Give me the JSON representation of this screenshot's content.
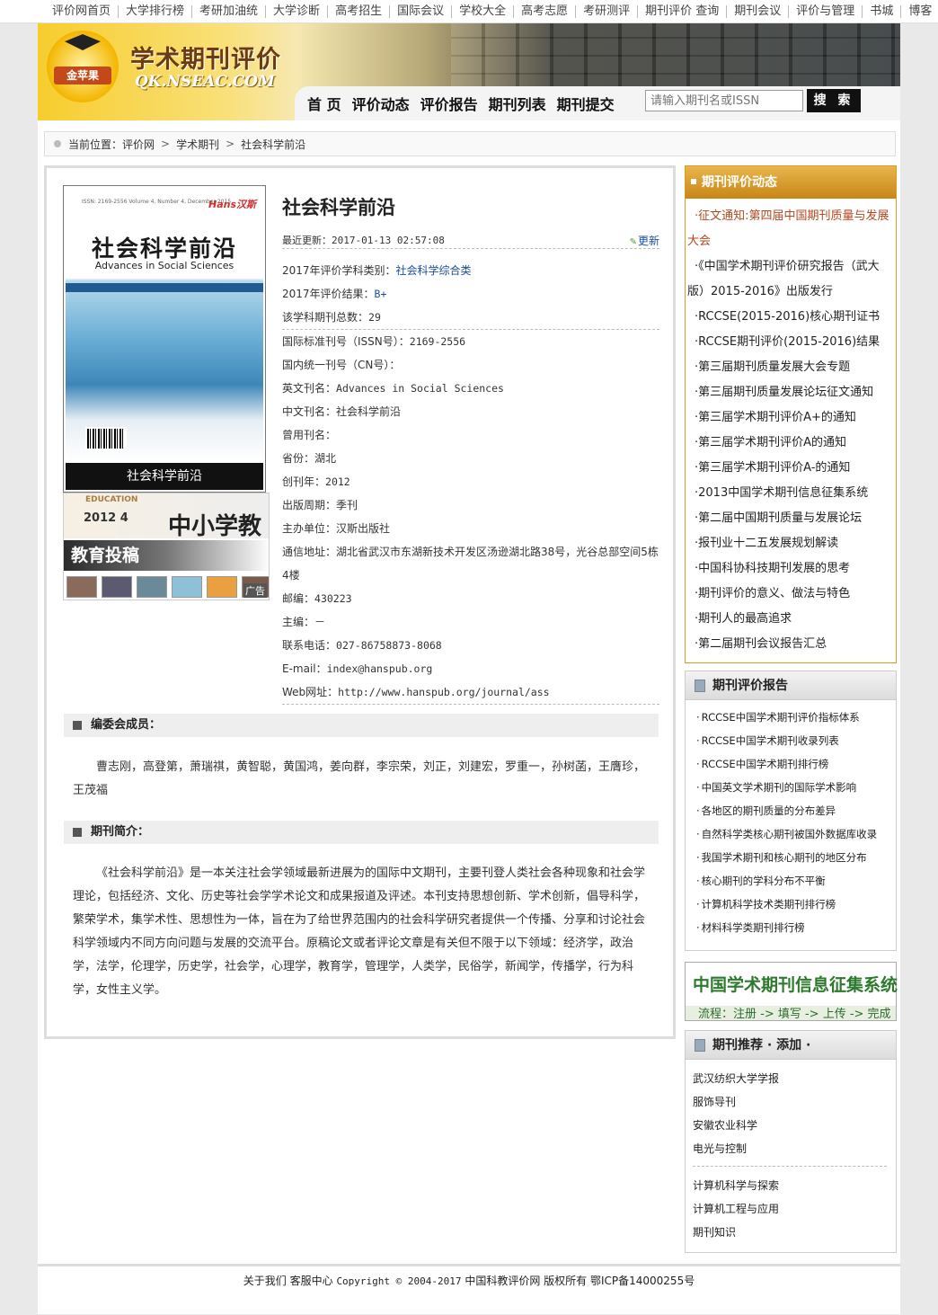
{
  "topnav": [
    "评价网首页",
    "大学排行榜",
    "考研加油统",
    "大学诊断",
    "高考招生",
    "国际会议",
    "学校大全",
    "高考志愿",
    "考研测评",
    "期刊评价 查询",
    "期刊会议",
    "评价与管理",
    "书城",
    "博客"
  ],
  "header": {
    "logo_text": "金苹果",
    "site_name": "学术期刊评价",
    "site_domain": "QK.NSEAC.COM",
    "nav": [
      "首 页",
      "评价动态",
      "评价报告",
      "期刊列表",
      "期刊提交"
    ],
    "search_placeholder": "请输入期刊名或ISSN",
    "search_button": "搜 索"
  },
  "breadcrumb": {
    "label": "当前位置：",
    "items": [
      "评价网",
      "学术期刊",
      "社会科学前沿"
    ],
    "sep": ">"
  },
  "cover": {
    "issn": "ISSN: 2169-2556   Volume 4, Number 4, December 2015",
    "publisher_mark": "Hans汉斯",
    "title": "社会科学前沿",
    "title_en": "Advances in Social Sciences",
    "caption": "社会科学前沿"
  },
  "ad": {
    "edu_text": "EDUCATION",
    "year_text": "2012 4",
    "big_text": "中小学教育",
    "label": "教育投稿",
    "tag": "广告",
    "thumb_colors": [
      "#8a6a5a",
      "#5b5a70",
      "#6a8a9a",
      "#8fc0d8",
      "#e8a040",
      "#7a5a4a"
    ]
  },
  "journal": {
    "title": "社会科学前沿",
    "update_label": "最近更新：",
    "update_time": "2017-01-13 02:57:08",
    "update_link": "更新",
    "fields": [
      {
        "label": "2017年评价学科类别：",
        "value": "社会科学综合类",
        "link": true
      },
      {
        "label": "2017年评价结果：",
        "value": "B+",
        "link": true
      },
      {
        "label": "该学科期刊总数：",
        "value": "29"
      },
      {
        "label": "国际标准刊号（ISSN号）：",
        "value": "2169-2556"
      },
      {
        "label": "国内统一刊号（CN号）：",
        "value": ""
      },
      {
        "label": "英文刊名：",
        "value": "Advances in Social Sciences"
      },
      {
        "label": "中文刊名：",
        "value": "社会科学前沿"
      },
      {
        "label": "曾用刊名：",
        "value": ""
      },
      {
        "label": "省份：",
        "value": "湖北"
      },
      {
        "label": "创刊年：",
        "value": "2012"
      },
      {
        "label": "出版周期：",
        "value": "季刊"
      },
      {
        "label": "主办单位：",
        "value": "汉斯出版社"
      },
      {
        "label": "通信地址：",
        "value": "湖北省武汉市东湖新技术开发区汤逊湖北路38号，光谷总部空间5栋4楼"
      },
      {
        "label": "邮编：",
        "value": "430223"
      },
      {
        "label": "主编：",
        "value": "－"
      },
      {
        "label": "联系电话：",
        "value": "027-86758873-8068"
      },
      {
        "label": "E-mail：",
        "value": "index@hanspub.org"
      },
      {
        "label": "Web网址：",
        "value": "http://www.hanspub.org/journal/ass"
      }
    ],
    "editorial_title": "编委会成员：",
    "editorial_members": "曹志刚，高登第，萧瑞祺，黄智聪，黄国鸿，姜向群，李宗荣，刘正，刘建宏，罗重一，孙树菡，王膺珍，王茂福",
    "intro_title": "期刊简介：",
    "intro_text": "《社会科学前沿》是一本关注社会学领域最新进展为的国际中文期刊，主要刊登人类社会各种现象和社会学理论，包括经济、文化、历史等社会学学术论文和成果报道及评述。本刊支持思想创新、学术创新，倡导科学，繁荣学术，集学术性、思想性为一体，旨在为了给世界范围内的社会科学研究者提供一个传播、分享和讨论社会科学领域内不同方向问题与发展的交流平台。原稿论文或者评论文章是有关但不限于以下领域：经济学，政治学，法学，伦理学，历史学，社会学，心理学，教育学，管理学，人类学，民俗学，新闻学，传播学，行为科学，女性主义学。"
  },
  "sidebar": {
    "news_title": "期刊评价动态",
    "news": [
      "·征文通知:第四届中国期刊质量与发展大会",
      "·《中国学术期刊评价研究报告（武大版）2015-2016》出版发行",
      "·RCCSE(2015-2016)核心期刊证书",
      "·RCCSE期刊评价(2015-2016)结果",
      "·第三届期刊质量发展大会专题",
      "·第三届期刊质量发展论坛征文通知",
      "·第三届学术期刊评价A+的通知",
      "·第三届学术期刊评价A的通知",
      "·第三届学术期刊评价A-的通知",
      "·2013中国学术期刊信息征集系统",
      "·第二届中国期刊质量与发展论坛",
      "·报刊业十二五发展规划解读",
      "·中国科协科技期刊发展的思考",
      "·期刊评价的意义、做法与特色",
      "·期刊人的最高追求",
      "·第二届期刊会议报告汇总"
    ],
    "report_title": "期刊评价报告",
    "reports": [
      "RCCSE中国学术期刊评价指标体系",
      "RCCSE中国学术期刊收录列表",
      "RCCSE中国学术期刊排行榜",
      "中国英文学术期刊的国际学术影响",
      "各地区的期刊质量的分布差异",
      "自然科学类核心期刊被国外数据库收录",
      "我国学术期刊和核心期刊的地区分布",
      "核心期刊的学科分布不平衡",
      "计算机科学技术类期刊排行榜",
      "材料科学类期刊排行榜"
    ],
    "banner_title": "中国学术期刊信息征集系统",
    "banner_flow": "流程：注册 -> 填写 -> 上传 -> 完成",
    "recommend_title": "期刊推荐 · 添加 ·",
    "recommend_a": [
      "武汉纺织大学学报",
      "服饰导刊",
      "安徽农业科学",
      "电光与控制"
    ],
    "recommend_b": [
      "计算机科学与探索",
      "计算机工程与应用",
      "期刊知识"
    ]
  },
  "footer": {
    "links": "关于我们 客服中心",
    "copyright": "Copyright © 2004-2017",
    "owner": "中国科教评价网 版权所有 鄂ICP备14000255号"
  }
}
